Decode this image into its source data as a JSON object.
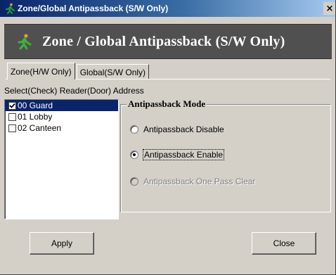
{
  "window": {
    "title": "Zone/Global Antipassback (S/W Only)",
    "close_glyph": "×"
  },
  "banner": {
    "title": "Zone / Global Antipassback (S/W Only)",
    "icon": "running-man-icon"
  },
  "tabs": [
    {
      "label": "Zone(H/W Only)",
      "active": true
    },
    {
      "label": "Global(S/W Only)",
      "active": false
    }
  ],
  "reader_section": {
    "label": "Select(Check) Reader(Door) Address",
    "items": [
      {
        "label": "00 Guard",
        "checked": true,
        "selected": true
      },
      {
        "label": "01 Lobby",
        "checked": false,
        "selected": false
      },
      {
        "label": "02 Canteen",
        "checked": false,
        "selected": false
      }
    ]
  },
  "mode_group": {
    "legend": "Antipassback Mode",
    "options": [
      {
        "label": "Antipassback Disable",
        "checked": false,
        "enabled": true
      },
      {
        "label": "Antipassback Enable",
        "checked": true,
        "enabled": true
      },
      {
        "label": "Antipassback One Pass Clear",
        "checked": false,
        "enabled": false
      }
    ]
  },
  "buttons": {
    "apply_label": "Apply",
    "close_label": "Close"
  },
  "colors": {
    "titlebar_start": "#0a246a",
    "titlebar_end": "#a6caf0",
    "face": "#d4d0c8",
    "banner": "#505050",
    "selection": "#0a246a",
    "icon_green": "#2e9a2e"
  }
}
